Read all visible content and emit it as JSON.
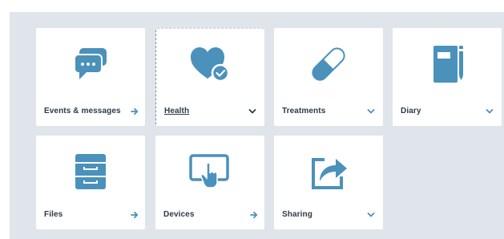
{
  "colors": {
    "page_background": "#ffffff",
    "dashboard_background": "#dfe5ea",
    "tile_background": "#ffffff",
    "icon_blue": "#4a91bb",
    "label_text": "#2e3a46"
  },
  "tiles": [
    {
      "label": "Events & messages",
      "icon": "chat-bubbles-icon",
      "action": "arrow-right-icon"
    },
    {
      "label": "Health",
      "icon": "heart-check-icon",
      "action": "chevron-down-icon",
      "focused": true
    },
    {
      "label": "Treatments",
      "icon": "pill-capsule-icon",
      "action": "chevron-down-icon"
    },
    {
      "label": "Diary",
      "icon": "notebook-icon",
      "action": "chevron-down-icon"
    },
    {
      "label": "Files",
      "icon": "file-cabinet-icon",
      "action": "arrow-right-icon"
    },
    {
      "label": "Devices",
      "icon": "tablet-touch-icon",
      "action": "arrow-right-icon"
    },
    {
      "label": "Sharing",
      "icon": "share-export-icon",
      "action": "chevron-down-icon"
    }
  ]
}
